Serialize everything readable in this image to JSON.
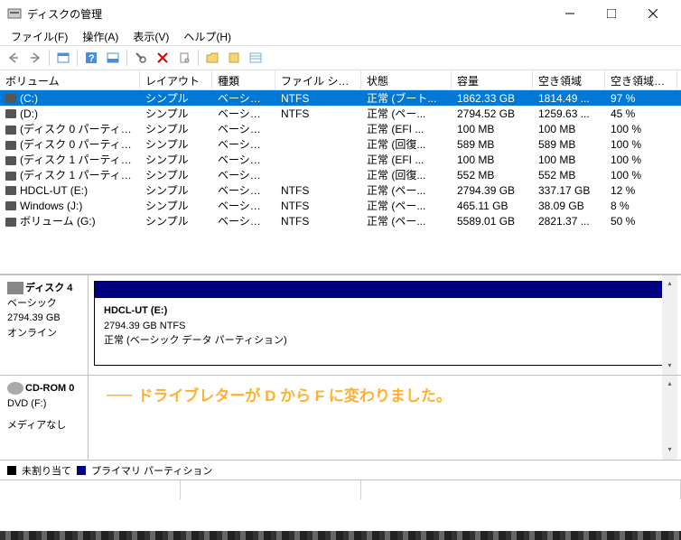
{
  "window": {
    "title": "ディスクの管理"
  },
  "menu": {
    "file": "ファイル(F)",
    "action": "操作(A)",
    "view": "表示(V)",
    "help": "ヘルプ(H)"
  },
  "columns": {
    "volume": "ボリューム",
    "layout": "レイアウト",
    "type": "種類",
    "filesystem": "ファイル システム",
    "status": "状態",
    "capacity": "容量",
    "free": "空き領域",
    "freepct": "空き領域の割..."
  },
  "rows": [
    {
      "vol": "(C:)",
      "layout": "シンプル",
      "type": "ベーシック",
      "fs": "NTFS",
      "status": "正常 (ブート...",
      "cap": "1862.33 GB",
      "free": "1814.49 ...",
      "pct": "97 %",
      "sel": true
    },
    {
      "vol": "(D:)",
      "layout": "シンプル",
      "type": "ベーシック",
      "fs": "NTFS",
      "status": "正常 (ペー...",
      "cap": "2794.52 GB",
      "free": "1259.63 ...",
      "pct": "45 %"
    },
    {
      "vol": "(ディスク 0 パーティシ...",
      "layout": "シンプル",
      "type": "ベーシック",
      "fs": "",
      "status": "正常 (EFI ...",
      "cap": "100 MB",
      "free": "100 MB",
      "pct": "100 %"
    },
    {
      "vol": "(ディスク 0 パーティシ...",
      "layout": "シンプル",
      "type": "ベーシック",
      "fs": "",
      "status": "正常 (回復...",
      "cap": "589 MB",
      "free": "589 MB",
      "pct": "100 %"
    },
    {
      "vol": "(ディスク 1 パーティシ...",
      "layout": "シンプル",
      "type": "ベーシック",
      "fs": "",
      "status": "正常 (EFI ...",
      "cap": "100 MB",
      "free": "100 MB",
      "pct": "100 %"
    },
    {
      "vol": "(ディスク 1 パーティシ...",
      "layout": "シンプル",
      "type": "ベーシック",
      "fs": "",
      "status": "正常 (回復...",
      "cap": "552 MB",
      "free": "552 MB",
      "pct": "100 %"
    },
    {
      "vol": "HDCL-UT (E:)",
      "layout": "シンプル",
      "type": "ベーシック",
      "fs": "NTFS",
      "status": "正常 (ペー...",
      "cap": "2794.39 GB",
      "free": "337.17 GB",
      "pct": "12 %"
    },
    {
      "vol": "Windows (J:)",
      "layout": "シンプル",
      "type": "ベーシック",
      "fs": "NTFS",
      "status": "正常 (ペー...",
      "cap": "465.11 GB",
      "free": "38.09 GB",
      "pct": "8 %"
    },
    {
      "vol": "ボリューム (G:)",
      "layout": "シンプル",
      "type": "ベーシック",
      "fs": "NTFS",
      "status": "正常 (ペー...",
      "cap": "5589.01 GB",
      "free": "2821.37 ...",
      "pct": "50 %"
    }
  ],
  "disk4": {
    "title": "ディスク 4",
    "type": "ベーシック",
    "size": "2794.39 GB",
    "state": "オンライン",
    "part_name": "HDCL-UT  (E:)",
    "part_size": "2794.39 GB NTFS",
    "part_status": "正常 (ベーシック データ パーティション)"
  },
  "cdrom": {
    "title": "CD-ROM 0",
    "drive": "DVD (F:)",
    "media": "メディアなし"
  },
  "annotation": "ドライブレターが D から F に変わりました。",
  "legend": {
    "unalloc": "未割り当て",
    "primary": "プライマリ パーティション"
  }
}
